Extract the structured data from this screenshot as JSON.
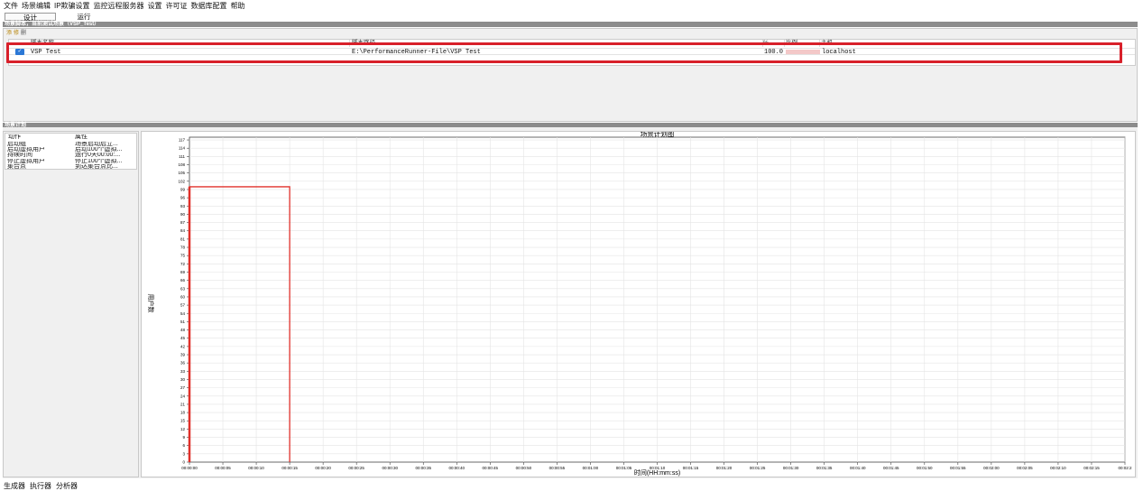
{
  "menu": [
    "文件",
    "场景编辑",
    "IP欺骗设置",
    "监控远程服务器",
    "设置",
    "许可证",
    "数据库配置",
    "帮助"
  ],
  "modes": {
    "design": "设计",
    "run": "运行"
  },
  "scripts_section_title": "场景脚本，当前测试场景（VSP_Test）",
  "script_toolbar": [
    "添",
    "修",
    "删"
  ],
  "script_table": {
    "headers": {
      "name": "脚本名称",
      "path": "脚本路径",
      "pct": "%",
      "ratio": "比例",
      "host": "主机"
    },
    "rows": [
      {
        "checked": true,
        "name": "VSP Test",
        "path": "E:\\PerformanceRunner-File\\VSP Test",
        "pct": "100.0",
        "host": "localhost"
      }
    ]
  },
  "schedule_section_title": "场景计划",
  "actions_table": {
    "headers": {
      "action": "动作",
      "property": "属性"
    },
    "rows": [
      {
        "action": "启动组",
        "property": "场景启动后立..."
      },
      {
        "action": "启动虚拟用户",
        "property": "启动100个虚拟..."
      },
      {
        "action": "持续时间",
        "property": "运行0天00:00:..."
      },
      {
        "action": "停止虚拟用户",
        "property": "停止100个虚拟..."
      },
      {
        "action": "集合点",
        "property": "到达集合点比..."
      }
    ]
  },
  "chart_data": {
    "type": "line",
    "title": "场景计划图",
    "xlabel": "时间(HH:mm:ss)",
    "ylabel": "用户数",
    "ylim": [
      0,
      118
    ],
    "yticks": [
      0,
      3,
      6,
      9,
      12,
      15,
      18,
      21,
      24,
      27,
      30,
      33,
      36,
      39,
      42,
      45,
      48,
      51,
      54,
      57,
      60,
      63,
      66,
      69,
      72,
      75,
      78,
      81,
      84,
      87,
      90,
      93,
      96,
      99,
      102,
      105,
      108,
      111,
      114,
      117
    ],
    "xticks": [
      "00:00:00",
      "00:00:05",
      "00:00:10",
      "00:00:15",
      "00:00:20",
      "00:00:25",
      "00:00:30",
      "00:00:35",
      "00:00:40",
      "00:00:45",
      "00:00:50",
      "00:00:55",
      "00:01:00",
      "00:01:05",
      "00:01:10",
      "00:01:15",
      "00:01:20",
      "00:01:25",
      "00:01:30",
      "00:01:35",
      "00:01:40",
      "00:01:45",
      "00:01:50",
      "00:01:55",
      "00:02:00",
      "00:02:05",
      "00:02:10",
      "00:02:15",
      "00:02:2"
    ],
    "series": [
      {
        "x": [
          0,
          0,
          15,
          15
        ],
        "y": [
          0,
          100,
          100,
          0
        ],
        "color": "#e0302a"
      }
    ],
    "grid": true,
    "plot_color": "#e0302a"
  },
  "statusbar": [
    "生成器",
    "执行器",
    "分析器"
  ]
}
